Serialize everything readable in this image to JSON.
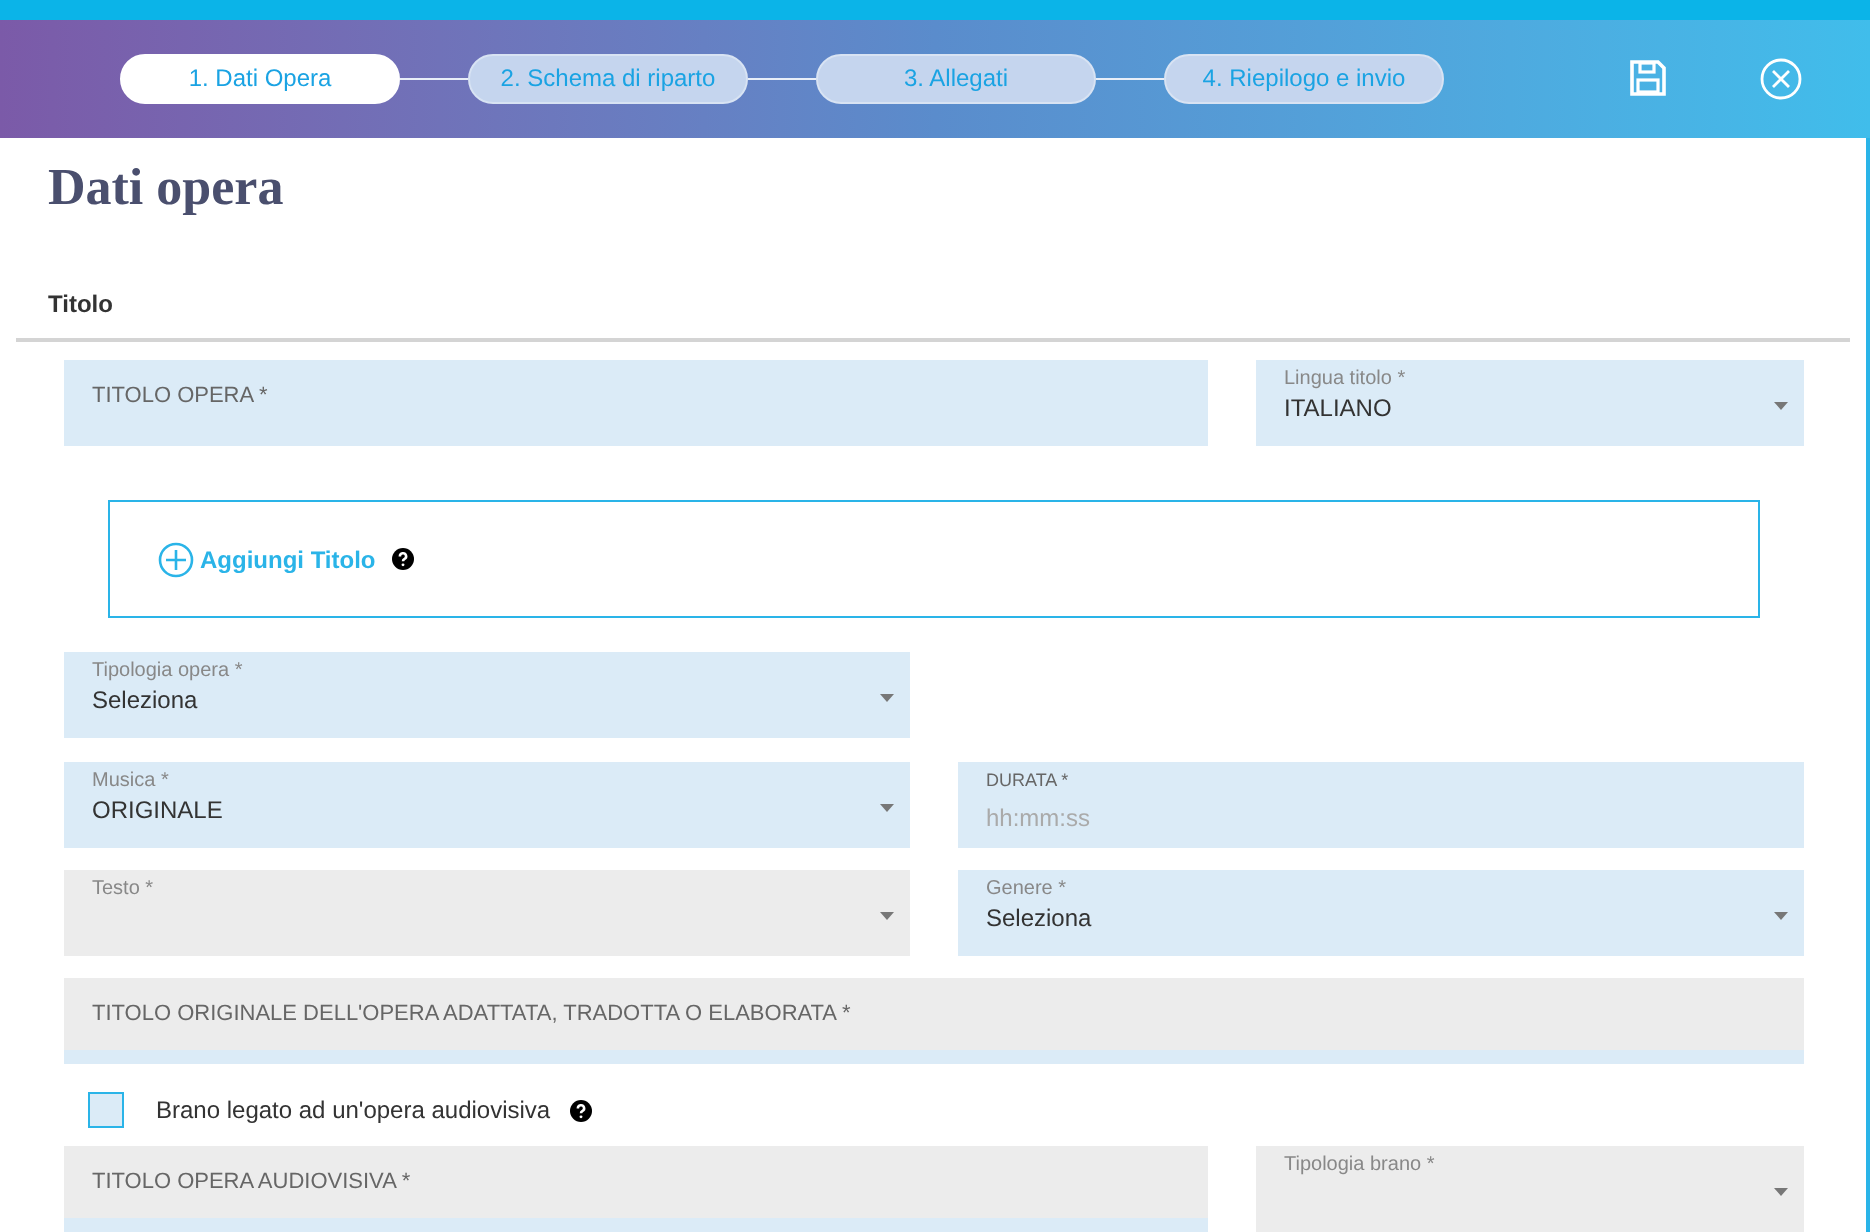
{
  "steps": [
    {
      "label": "1. Dati Opera",
      "selected": true
    },
    {
      "label": "2. Schema di riparto",
      "selected": false
    },
    {
      "label": "3. Allegati",
      "selected": false
    },
    {
      "label": "4. Riepilogo e invio",
      "selected": false
    }
  ],
  "heading": "Dati opera",
  "section": "Titolo",
  "titolo_opera": {
    "kind": "input",
    "placeholder": "TITOLO OPERA *",
    "disabled": false
  },
  "lingua_titolo": {
    "kind": "select",
    "label": "Lingua titolo *",
    "value": "ITALIANO",
    "disabled": false
  },
  "add_title": {
    "label": "Aggiungi Titolo"
  },
  "tipologia_opera": {
    "kind": "select",
    "label": "Tipologia opera *",
    "value": "Seleziona",
    "disabled": false
  },
  "musica": {
    "kind": "select",
    "label": "Musica *",
    "value": "ORIGINALE",
    "disabled": false
  },
  "durata": {
    "kind": "labeled_input",
    "label": "DURATA *",
    "placeholder": "hh:mm:ss",
    "disabled": false
  },
  "testo": {
    "kind": "select",
    "label": "Testo *",
    "disabled": true
  },
  "genere": {
    "kind": "select",
    "label": "Genere *",
    "value": "Seleziona",
    "disabled": false
  },
  "titolo_originale": {
    "kind": "input",
    "placeholder": "TITOLO ORIGINALE DELL'OPERA ADATTATA, TRADOTTA O ELABORATA *",
    "disabled": true
  },
  "brano_legato": {
    "label": "Brano legato ad un'opera audiovisiva",
    "checked": false
  },
  "titolo_audiovisiva": {
    "kind": "input",
    "placeholder": "TITOLO OPERA AUDIOVISIVA *",
    "disabled": true
  },
  "tipologia_brano": {
    "kind": "select",
    "label": "Tipologia brano *",
    "disabled": true
  }
}
